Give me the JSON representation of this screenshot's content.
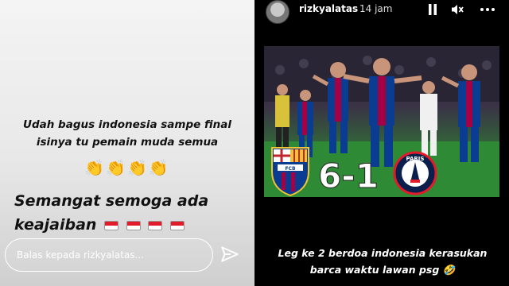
{
  "left_story": {
    "caption_line1": "Udah bagus indonesia sampe final",
    "caption_line2": "isinya tu pemain muda semua",
    "clap_emojis": "👏👏👏👏",
    "caption2_line1": "Semangat semoga ada",
    "caption2_line2": "keajaiban",
    "reply_placeholder": "Balas kepada rizkyalatas..."
  },
  "right_story": {
    "username": "rizkyalatas",
    "time_ago": "14 jam",
    "score": "6-1",
    "barca_crest_text": "FCB",
    "psg_crest_text": "PARIS",
    "caption_line1": "Leg ke 2 berdoa indonesia kerasukan",
    "caption_line2": "barca waktu lawan psg 🤣"
  },
  "colors": {
    "barca_blue": "#0a3d91",
    "barca_red": "#a50044",
    "psg_navy": "#0b1f4d",
    "indonesia_red": "#e21b2a"
  }
}
